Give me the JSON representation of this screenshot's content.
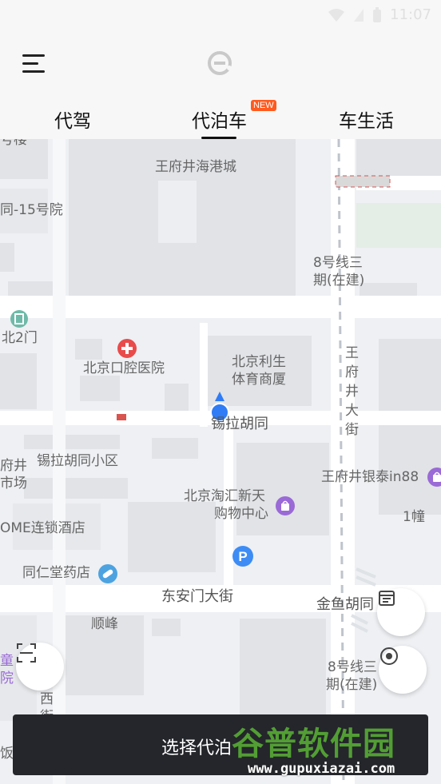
{
  "status_bar": {
    "time": "11:07"
  },
  "header": {
    "tabs": [
      {
        "label": "代驾"
      },
      {
        "label": "代泊车",
        "badge": "NEW",
        "active": true
      },
      {
        "label": "车生活"
      }
    ]
  },
  "map": {
    "labels": {
      "wangfujing_haigang": "王府井海港城",
      "hutong_15": "同-15号院",
      "line8_a": "8号线三",
      "line8_a2": "期(在建)",
      "bei2men": "北2门",
      "kouqiang_hospital": "北京口腔医院",
      "lisheng_1": "北京利生",
      "lisheng_2": "体育商厦",
      "wangfujing_street": "王府井大街",
      "xila_hutong": "锡拉胡同",
      "xila_hutong_xiaoqu": "锡拉胡同小区",
      "fujing_shichang": "府井",
      "shichang": "市场",
      "yintai": "王府井银泰in88",
      "haihui_1": "北京淘汇新天",
      "haihui_2": "购物中心",
      "ome_hotel": "OME连锁酒店",
      "yichuang": "1幢",
      "tongrentang": "同仁堂药店",
      "dongan_street": "东安门大街",
      "jinyu_hutong": "金鱼胡同",
      "shunfeng": "顺峰",
      "line8_b": "8号线三",
      "line8_b2": "期(在建)",
      "tong": "童",
      "yuan": "院",
      "xi": "西",
      "jie": "街",
      "dian": "饭店",
      "hao_lou": "号楼"
    }
  },
  "bottom_bar": {
    "label": "选择代泊"
  },
  "watermark": {
    "brand": "谷普软件园",
    "url": "www.gupuxiazai.com"
  },
  "colors": {
    "accent": "#2f7cf6",
    "hospital_red": "#e94b4b",
    "poi_purple": "#9a6ad6",
    "parking_blue": "#3d8cf5",
    "badge_orange": "#ff5a1f"
  }
}
